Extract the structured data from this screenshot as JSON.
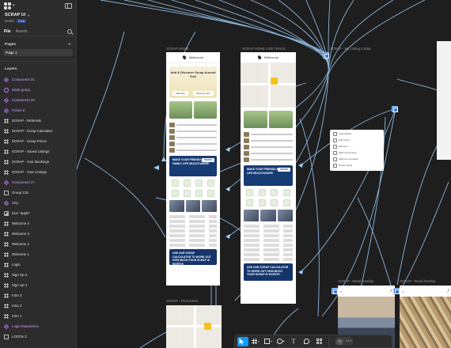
{
  "project": {
    "name": "SCRAP UI",
    "location": "Drafts",
    "plan_badge": "Free"
  },
  "panel_tabs": [
    {
      "label": "File",
      "active": true
    },
    {
      "label": "Assets",
      "active": false
    }
  ],
  "pages": {
    "heading": "Pages",
    "items": [
      "Page 1"
    ]
  },
  "layers": {
    "heading": "Layers",
    "items": [
      {
        "label": "Component 31",
        "kind": "component"
      },
      {
        "label": "Mask group",
        "kind": "mask"
      },
      {
        "label": "Component 29",
        "kind": "component"
      },
      {
        "label": "Frame 8",
        "kind": "component"
      },
      {
        "label": "SCRAP - Referrals",
        "kind": "frame"
      },
      {
        "label": "SCRAP - Scrap Calculator",
        "kind": "frame"
      },
      {
        "label": "SCRAP - Scrap Prices",
        "kind": "frame"
      },
      {
        "label": "SCRAP - Saved Listings",
        "kind": "frame"
      },
      {
        "label": "SCRAP - Your Bookings",
        "kind": "frame"
      },
      {
        "label": "SCRAP - Your Listings",
        "kind": "frame"
      },
      {
        "label": "Component 27",
        "kind": "component"
      },
      {
        "label": "Group 218",
        "kind": "group"
      },
      {
        "label": "Skip",
        "kind": "component"
      },
      {
        "label": "icon \"apple\"",
        "kind": "image"
      },
      {
        "label": "Welcome 4",
        "kind": "frame"
      },
      {
        "label": "Welcome 3",
        "kind": "frame"
      },
      {
        "label": "Welcome 2",
        "kind": "frame"
      },
      {
        "label": "Welcome 1",
        "kind": "frame"
      },
      {
        "label": "Login",
        "kind": "frame"
      },
      {
        "label": "Sign Up 2",
        "kind": "frame"
      },
      {
        "label": "Sign Up 1",
        "kind": "frame"
      },
      {
        "label": "Intro 3",
        "kind": "frame"
      },
      {
        "label": "Intro 2",
        "kind": "frame"
      },
      {
        "label": "Intro 1",
        "kind": "frame"
      },
      {
        "label": "Login Experience",
        "kind": "component"
      },
      {
        "label": "LOGOs 3",
        "kind": "group"
      }
    ]
  },
  "canvas": {
    "frame_labels": {
      "home": "SCRAP HOME",
      "home_live": "SCRAP HOME LIVE TRACK",
      "listing": "SCRAP - My Listing 3 Step",
      "tracking": "SCRAP - TRACKING",
      "metal": "SCRAP - Metal Overlay",
      "wood": "SCRAP - Wood Overlay"
    },
    "phone": {
      "location": "Melbourne",
      "hero_title": "Add & Discover Scrap Around You!",
      "hero_btn_left": "Add Item",
      "hero_btn_right": "Discover Item",
      "promo": "MAKE YOUR FRIENDS & FAMILY LIFE MUCH EASIER!",
      "promo_btn": "INVITE",
      "footer_promo": "USE OUR SCRAP CALCULATOR TO WORK OUT HOW MUCH YOUR SCRAP IS WORTH!"
    },
    "menu_items": [
      "View details",
      "Edit listing",
      "Edit item",
      "Mark as Pending",
      "Mark as Complete",
      "Delete listing"
    ]
  },
  "toolbar": {
    "tools": [
      {
        "icon": "move-icon",
        "active": true
      },
      {
        "icon": "frame-icon",
        "active": false
      },
      {
        "icon": "rectangle-icon",
        "active": false
      },
      {
        "icon": "pen-icon",
        "active": false
      },
      {
        "icon": "text-icon",
        "active": false,
        "glyph": "T"
      },
      {
        "icon": "comment-icon",
        "active": false
      },
      {
        "icon": "widgets-icon",
        "active": false
      },
      {
        "icon": "code-icon",
        "active": false,
        "glyph": "</>"
      }
    ]
  },
  "colors": {
    "accent": "#0d99ff",
    "component": "#c7a2ff",
    "wire": "#8ec5ff",
    "panel": "#2c2c2c",
    "canvas": "#1e1e1e"
  }
}
